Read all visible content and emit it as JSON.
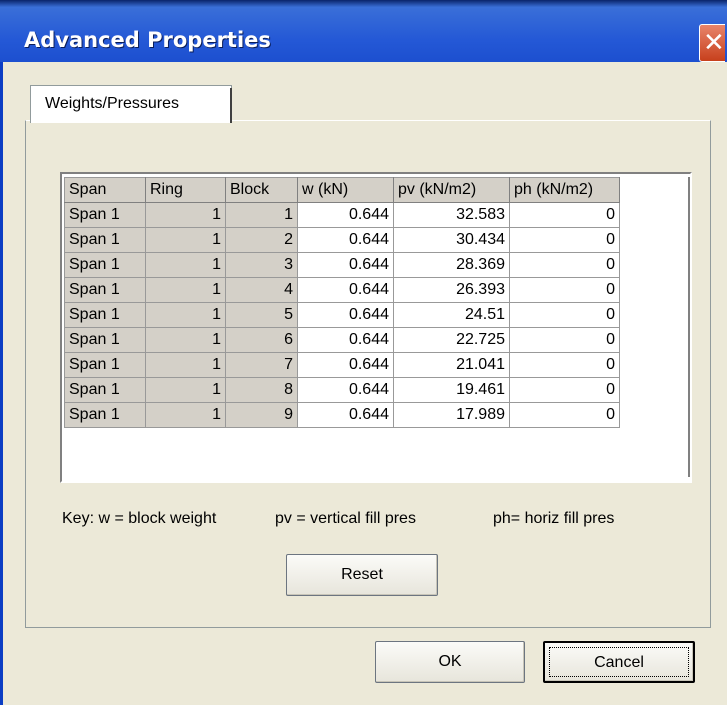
{
  "window": {
    "title": "Advanced Properties"
  },
  "tabs": [
    {
      "label": "Weights/Pressures"
    }
  ],
  "grid": {
    "columns": [
      "Span",
      "Ring",
      "Block",
      "w (kN)",
      "pv (kN/m2)",
      "ph (kN/m2)"
    ],
    "rows": [
      [
        "Span 1",
        "1",
        "1",
        "0.644",
        "32.583",
        "0"
      ],
      [
        "Span 1",
        "1",
        "2",
        "0.644",
        "30.434",
        "0"
      ],
      [
        "Span 1",
        "1",
        "3",
        "0.644",
        "28.369",
        "0"
      ],
      [
        "Span 1",
        "1",
        "4",
        "0.644",
        "26.393",
        "0"
      ],
      [
        "Span 1",
        "1",
        "5",
        "0.644",
        "24.51",
        "0"
      ],
      [
        "Span 1",
        "1",
        "6",
        "0.644",
        "22.725",
        "0"
      ],
      [
        "Span 1",
        "1",
        "7",
        "0.644",
        "21.041",
        "0"
      ],
      [
        "Span 1",
        "1",
        "8",
        "0.644",
        "19.461",
        "0"
      ],
      [
        "Span 1",
        "1",
        "9",
        "0.644",
        "17.989",
        "0"
      ]
    ]
  },
  "key": {
    "w": "Key: w = block weight",
    "pv": "pv = vertical fill pres",
    "ph": "ph= horiz fill pres"
  },
  "buttons": {
    "reset": "Reset",
    "ok": "OK",
    "cancel": "Cancel"
  },
  "icons": {
    "close": "close-icon",
    "scroll_up": "scroll-up-icon",
    "scroll_down": "scroll-down-icon"
  }
}
